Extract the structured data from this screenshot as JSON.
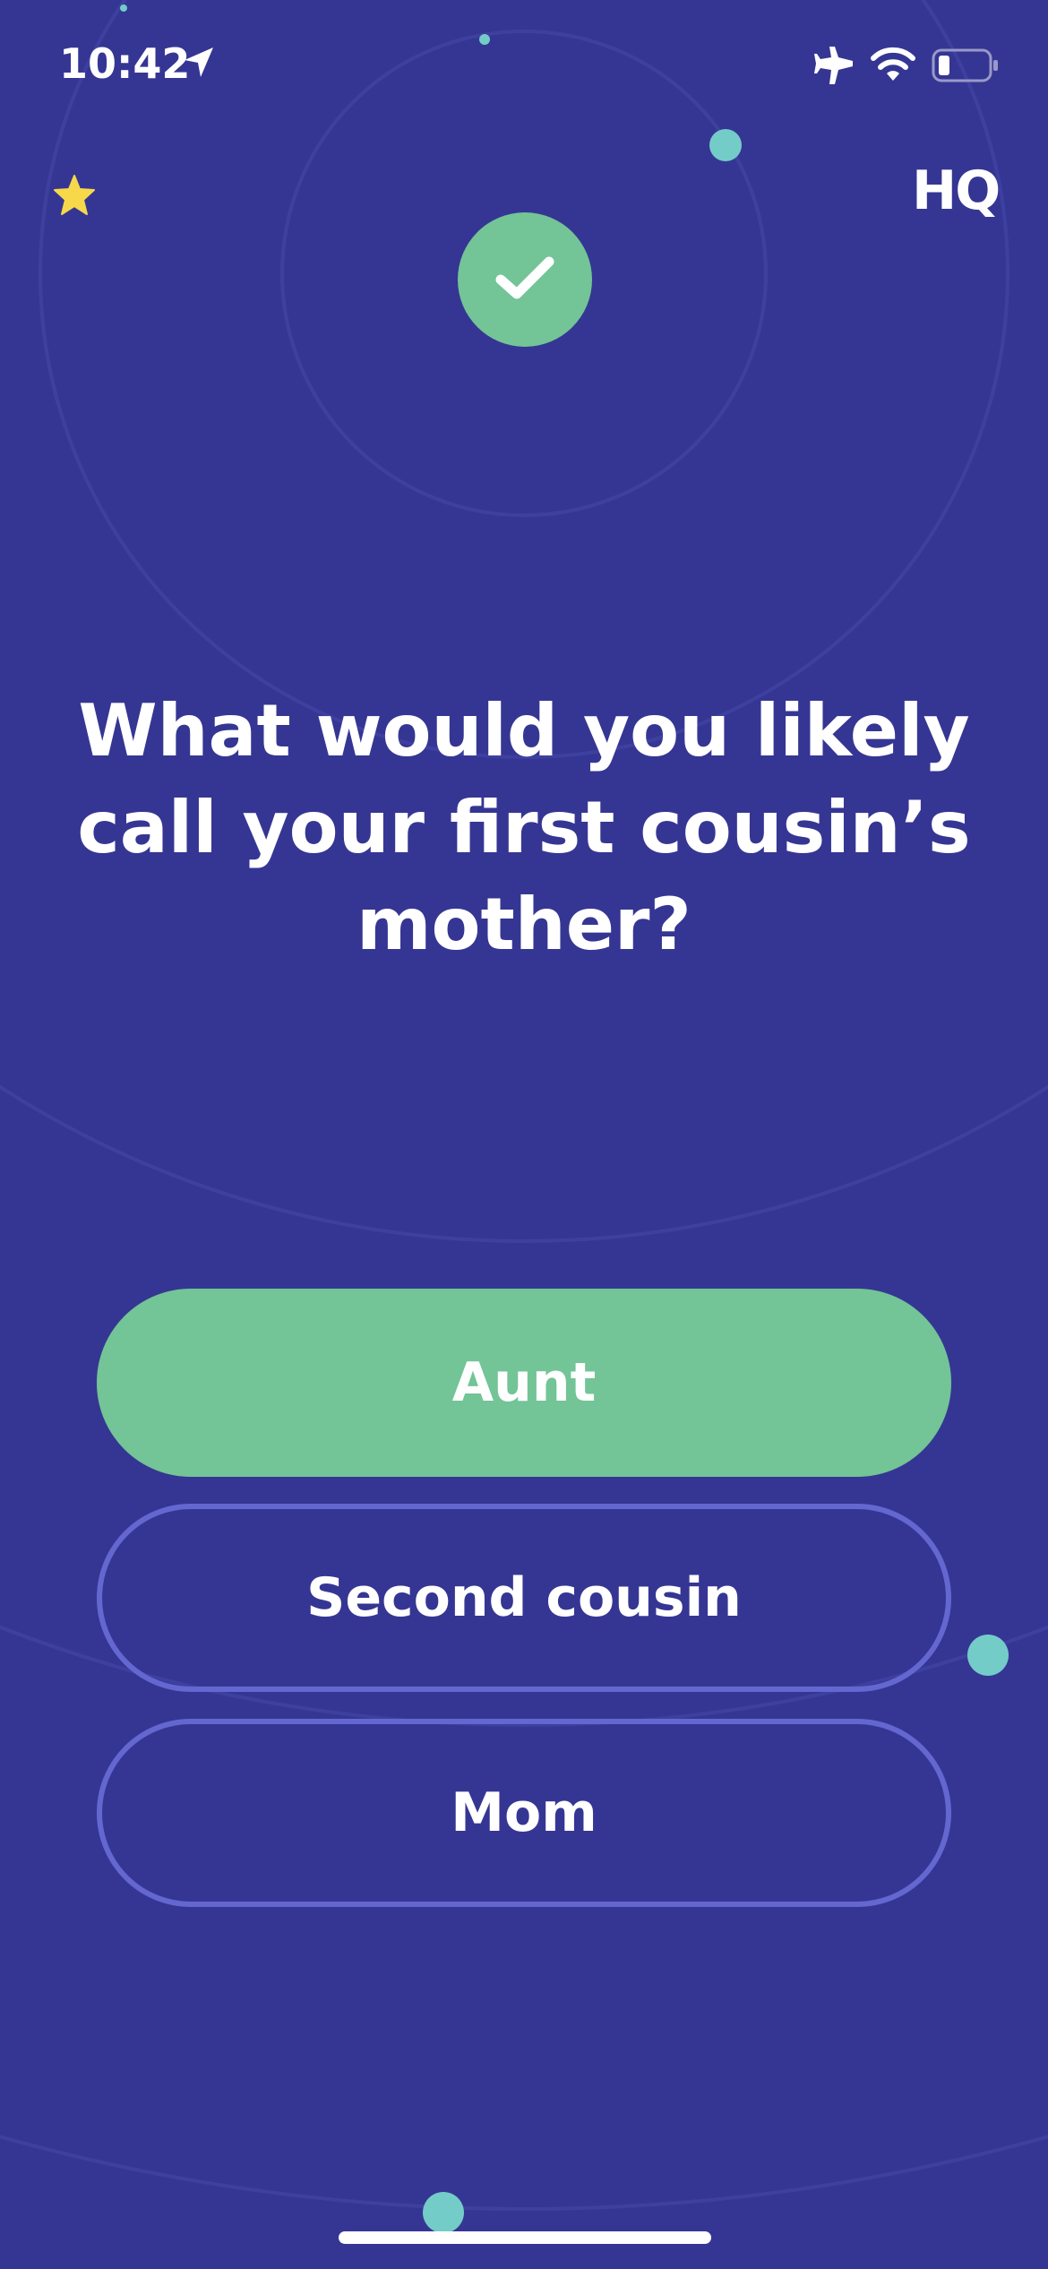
{
  "status_bar": {
    "time": "10:42",
    "icons": [
      "location-arrow-icon",
      "airplane-icon",
      "wifi-icon",
      "battery-icon"
    ]
  },
  "header": {
    "logo_text": "HQ",
    "star_icon": "star-icon"
  },
  "result": {
    "icon": "checkmark-icon"
  },
  "question": {
    "text": "What would you likely call your first cousin’s mother?"
  },
  "answers": [
    {
      "label": "Aunt",
      "state": "correct"
    },
    {
      "label": "Second cousin",
      "state": "default"
    },
    {
      "label": "Mom",
      "state": "default"
    }
  ],
  "colors": {
    "background": "#353693",
    "correct": "#73c496",
    "outline": "#6467d0",
    "accent_dot": "#73ccc8",
    "star": "#f7d84a"
  }
}
